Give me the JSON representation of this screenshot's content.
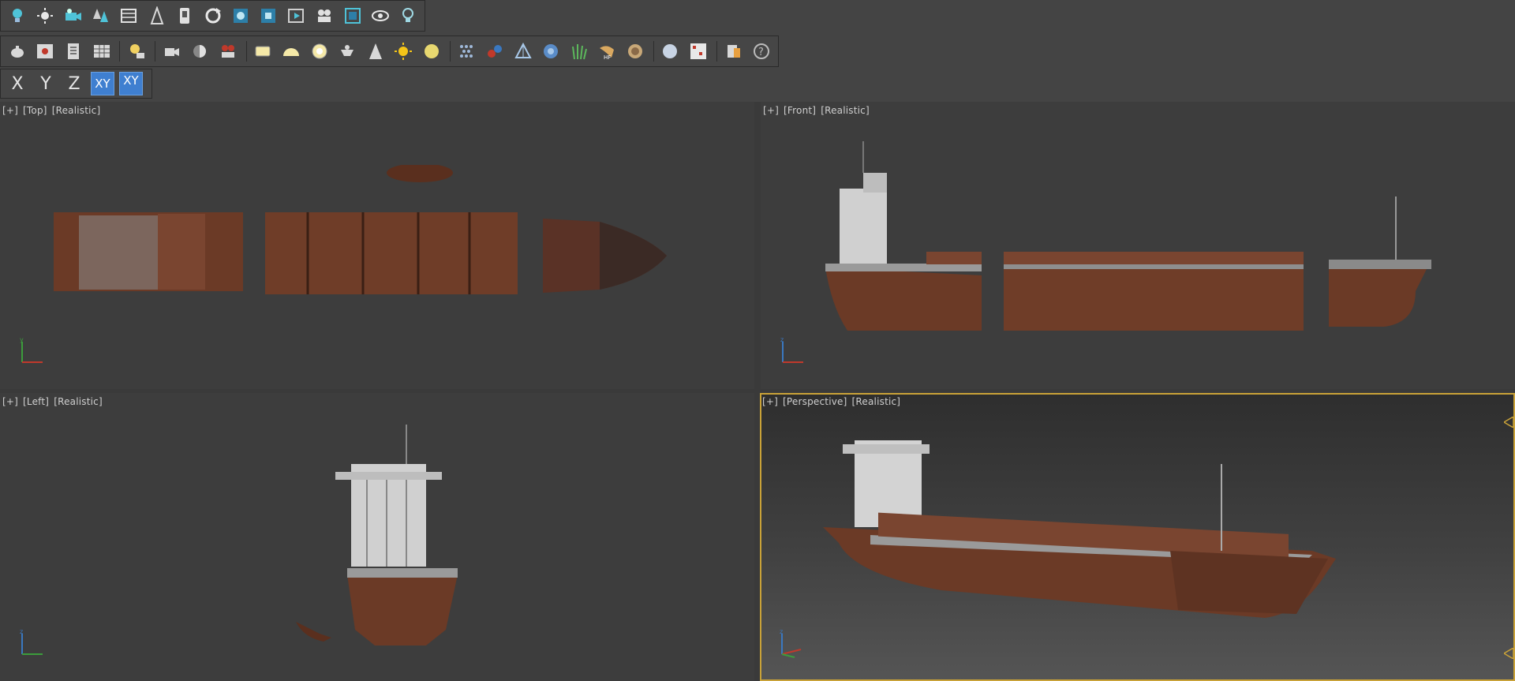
{
  "toolbars": {
    "main_tools": [
      {
        "name": "light-bulb-icon"
      },
      {
        "name": "sun-icon"
      },
      {
        "name": "camera-icon"
      },
      {
        "name": "foliage-icon"
      },
      {
        "name": "render-frame-icon"
      },
      {
        "name": "geometry-icon"
      },
      {
        "name": "proxy-icon"
      },
      {
        "name": "refresh-icon"
      },
      {
        "name": "material-editor-icon"
      },
      {
        "name": "render-region-icon"
      },
      {
        "name": "frame-buffer-icon"
      },
      {
        "name": "animation-icon"
      },
      {
        "name": "viewport-icon"
      },
      {
        "name": "eye-icon"
      },
      {
        "name": "lightbulb-outline-icon"
      }
    ],
    "render_tools": [
      {
        "name": "teapot-icon"
      },
      {
        "name": "render-setup-icon"
      },
      {
        "name": "list-icon"
      },
      {
        "name": "grid-table-icon"
      },
      {
        "name": "light-lister-icon"
      },
      {
        "name": "camera-film-icon"
      },
      {
        "name": "exposure-icon"
      },
      {
        "name": "video-camera-icon"
      },
      {
        "name": "plane-light-icon"
      },
      {
        "name": "dome-light-icon"
      },
      {
        "name": "sphere-light-icon"
      },
      {
        "name": "ies-light-icon"
      },
      {
        "name": "spot-light-icon"
      },
      {
        "name": "sunlight-icon"
      },
      {
        "name": "ambient-light-icon"
      },
      {
        "name": "fur-icon"
      },
      {
        "name": "molecule-icon"
      },
      {
        "name": "decal-icon"
      },
      {
        "name": "texture-icon"
      },
      {
        "name": "grass-icon"
      },
      {
        "name": "hair-icon"
      },
      {
        "name": "shell-icon"
      },
      {
        "name": "sphere-material-icon"
      },
      {
        "name": "asset-browser-icon"
      },
      {
        "name": "clipper-icon"
      },
      {
        "name": "help-icon"
      }
    ],
    "axis": {
      "x_label": "X",
      "y_label": "Y",
      "z_label": "Z",
      "xy_label": "XY",
      "xy_snap_label": "XY"
    }
  },
  "viewports": {
    "top": {
      "plus": "[+]",
      "view": "[Top]",
      "shading": "[Realistic]"
    },
    "front": {
      "plus": "[+]",
      "view": "[Front]",
      "shading": "[Realistic]"
    },
    "left": {
      "plus": "[+]",
      "view": "[Left]",
      "shading": "[Realistic]"
    },
    "perspective": {
      "plus": "[+]",
      "view": "[Perspective]",
      "shading": "[Realistic]"
    }
  },
  "colors": {
    "active_viewport_border": "#c9a238",
    "axis_active": "#3f7fd0",
    "hull_rust": "#6b3a26",
    "superstructure": "#d8d8d8"
  }
}
